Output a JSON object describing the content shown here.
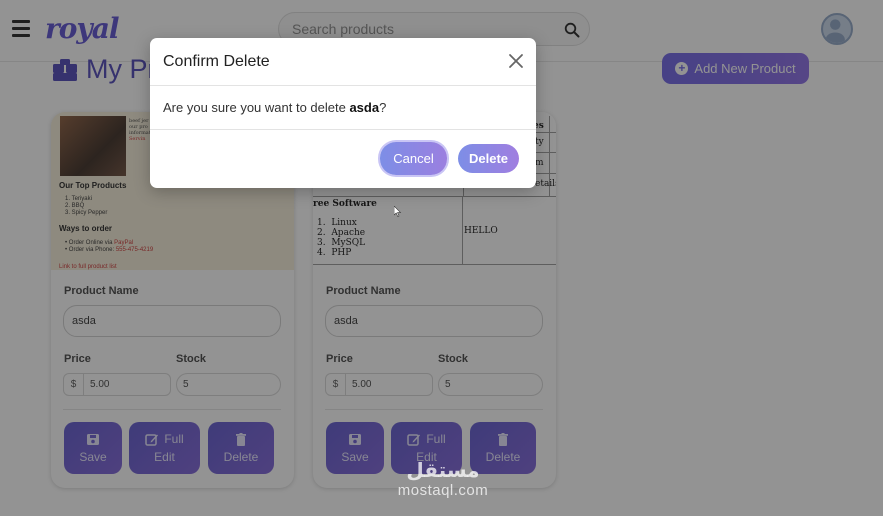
{
  "app": {
    "logo": "royal"
  },
  "search": {
    "placeholder": "Search products"
  },
  "page": {
    "title": "My Pr",
    "add_label": "Add New Product"
  },
  "cards": [
    {
      "preview": {
        "caption": [
          "beef jer",
          "our pro",
          "informat",
          "Servin"
        ],
        "heading_products": "Our Top Products",
        "products": [
          "Teriyaki",
          "BBQ",
          "Spicy Pepper"
        ],
        "heading_order": "Ways to order",
        "order_online": "Order Online via",
        "order_online_link": "PayPal",
        "order_phone": "Order via Phone:",
        "order_phone_num": "555-475-4219",
        "footer": "Link to full product list"
      },
      "name_label": "Product Name",
      "name_value": "asda",
      "price_label": "Price",
      "currency": "$",
      "price_value": "5.00",
      "stock_label": "Stock",
      "stock_value": "5",
      "save": "Save",
      "full": "Full",
      "edit": "Edit",
      "delete": "Delete"
    },
    {
      "preview": {
        "col_head": "es",
        "rows": [
          "ty",
          "m",
          "etails"
        ],
        "free_heading": "ree Software",
        "software": [
          "Linux",
          "Apache",
          "MySQL",
          "PHP"
        ],
        "hello": "HELLO"
      },
      "name_label": "Product Name",
      "name_value": "asda",
      "price_label": "Price",
      "currency": "$",
      "price_value": "5.00",
      "stock_label": "Stock",
      "stock_value": "5",
      "save": "Save",
      "full": "Full",
      "edit": "Edit",
      "delete": "Delete"
    }
  ],
  "modal": {
    "title": "Confirm Delete",
    "message_prefix": "Are you sure you want to delete ",
    "item_name": "asda",
    "message_suffix": "?",
    "cancel": "Cancel",
    "confirm": "Delete"
  },
  "watermark": {
    "arabic": "مستقل",
    "latin": "mostaql.com"
  },
  "colors": {
    "accent": "#5b4fd1",
    "button": "#6d63e6",
    "overlay": "rgba(30,30,30,0.48)"
  }
}
